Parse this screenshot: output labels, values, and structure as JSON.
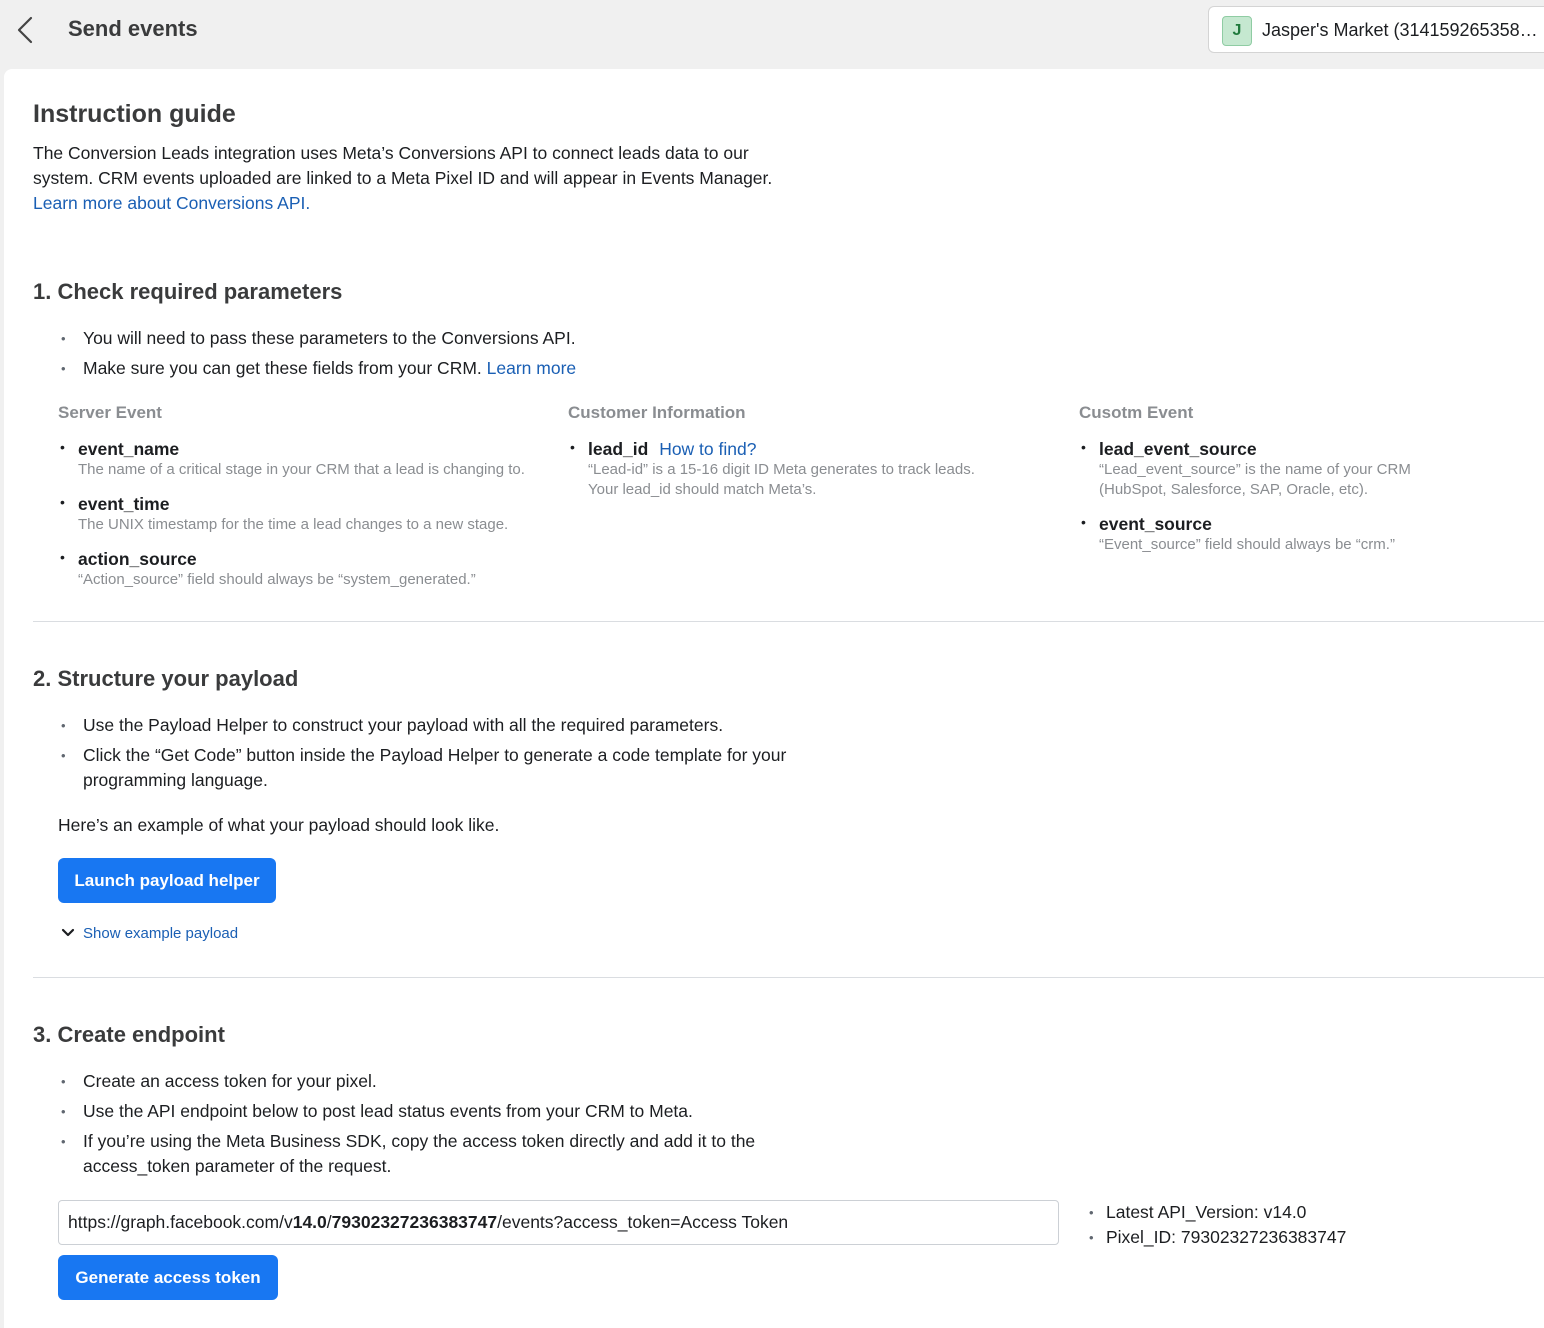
{
  "header": {
    "title": "Send events",
    "account_initial": "J",
    "account_name": "Jasper's Market (3141592653589..."
  },
  "guide": {
    "title": "Instruction guide",
    "intro": "The Conversion Leads integration uses Meta’s Conversions API to connect leads data to our system. CRM events uploaded are linked to a Meta Pixel ID and will appear in Events Manager.",
    "intro_link": "Learn more about Conversions API."
  },
  "step1": {
    "title": "1. Check required parameters",
    "bullet1": "You will need to pass these parameters to the Conversions API.",
    "bullet2": "Make sure you can get these fields from your CRM.",
    "bullet2_link": "Learn more",
    "columns": [
      {
        "heading": "Server Event",
        "params": [
          {
            "name": "event_name",
            "desc": "The name of a critical stage in your CRM that a lead is changing to."
          },
          {
            "name": "event_time",
            "desc": "The UNIX timestamp for the time a lead changes to a new stage."
          },
          {
            "name": "action_source",
            "desc": "“Action_source” field should always be “system_generated.”"
          }
        ]
      },
      {
        "heading": "Customer Information",
        "params": [
          {
            "name": "lead_id",
            "link": "How to find?",
            "desc": "“Lead-id” is a 15-16 digit ID Meta generates to track leads. Your lead_id should match Meta’s."
          }
        ]
      },
      {
        "heading": "Cusotm Event",
        "params": [
          {
            "name": "lead_event_source",
            "desc": "“Lead_event_source” is the name of your CRM (HubSpot, Salesforce, SAP, Oracle, etc)."
          },
          {
            "name": "event_source",
            "desc": "“Event_source” field should always be “crm.”"
          }
        ]
      }
    ]
  },
  "step2": {
    "title": "2. Structure your payload",
    "bullet1": "Use the Payload Helper to construct your payload with all the required parameters.",
    "bullet2": "Click the “Get Code” button inside the Payload Helper to generate a code template for your programming language.",
    "example_text": "Here’s an example of what your payload should look like.",
    "launch_button": "Launch payload helper",
    "show_example": "Show example payload"
  },
  "step3": {
    "title": "3. Create endpoint",
    "bullet1": "Create an access token for your pixel.",
    "bullet2": "Use the API endpoint below to post lead status events from your CRM to Meta.",
    "bullet3": "If you’re using the Meta Business SDK, copy the access token directly and add it to the access_token parameter of the request.",
    "endpoint_prefix": "https://graph.facebook.com/v",
    "endpoint_version": "14.0",
    "endpoint_sep": "/",
    "endpoint_pixel": "79302327236383747",
    "endpoint_suffix": "/events?access_token=Access Token",
    "api_version": "Latest API_Version: v14.0",
    "pixel_id": "Pixel_ID: 79302327236383747",
    "generate_button": "Generate access token"
  }
}
